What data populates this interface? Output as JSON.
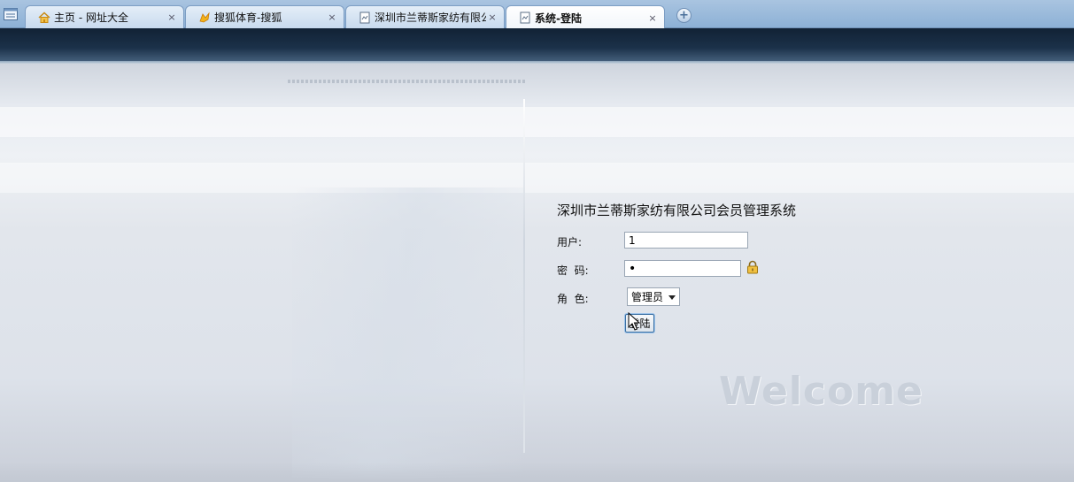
{
  "browser": {
    "tabs": [
      {
        "title": "主页 - 网址大全",
        "icon": "home-icon",
        "active": false
      },
      {
        "title": "搜狐体育-搜狐",
        "icon": "sohu-fox-icon",
        "active": false
      },
      {
        "title": "深圳市兰蒂斯家纺有限公...",
        "icon": "page-icon",
        "active": false
      },
      {
        "title": "系统-登陆",
        "icon": "page-icon",
        "active": true
      }
    ],
    "close_glyph": "×",
    "new_tab_glyph": "+"
  },
  "login": {
    "title": "深圳市兰蒂斯家纺有限公司会员管理系统",
    "user_label": "用户:",
    "user_value": "1",
    "password_label": "密  码:",
    "password_value": "•",
    "role_label": "角  色:",
    "role_selected": "管理员",
    "submit_label": "登陆"
  },
  "decor": {
    "welcome_text": "Welcome"
  },
  "colors": {
    "header_dark": "#14263a",
    "tabstrip": "#8db1d6",
    "button_border": "#3a6fa3"
  }
}
